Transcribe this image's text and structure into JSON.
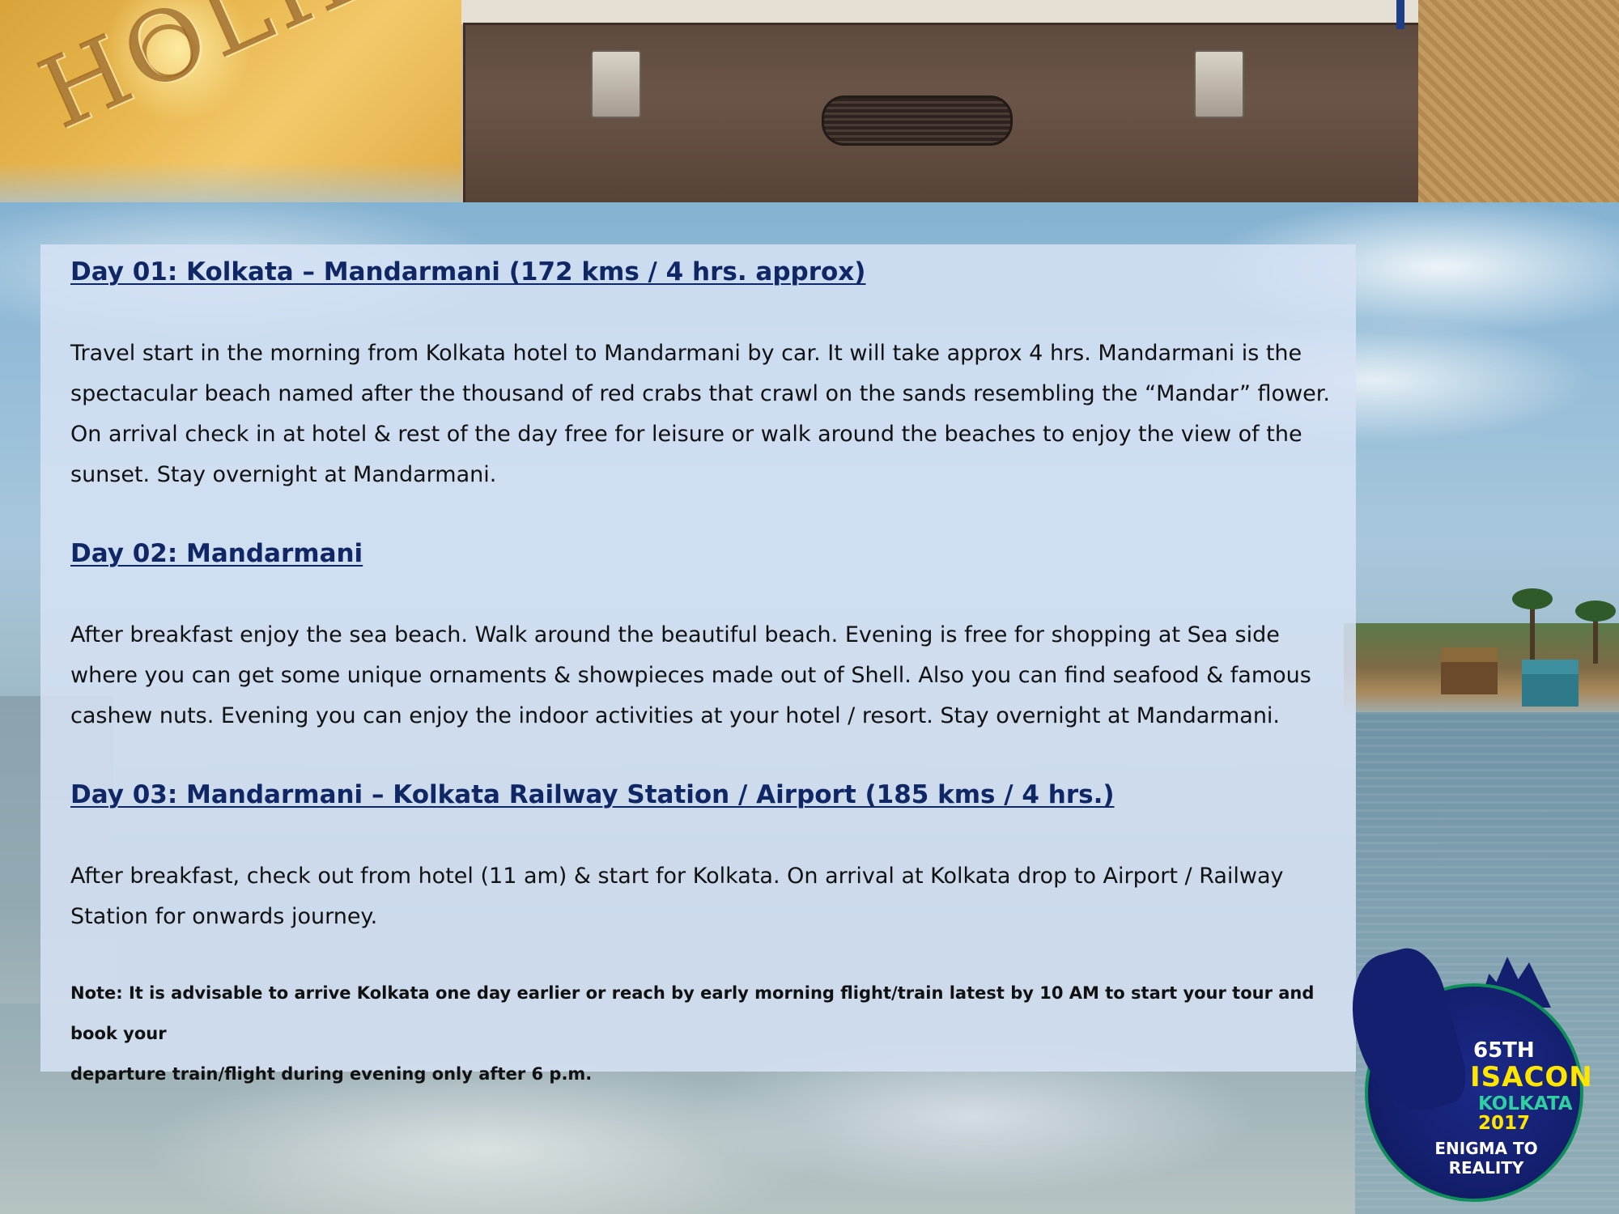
{
  "banner": {
    "holiday_word": "HOLIDAY"
  },
  "itinerary": {
    "day1": {
      "heading": "Day 01: Kolkata – Mandarmani (172 kms / 4 hrs. approx)",
      "body": "Travel start in the morning from Kolkata hotel to Mandarmani by car. It will take approx 4 hrs. Mandarmani is the\nspectacular beach named after the thousand of red crabs that crawl on the sands resembling the “Mandar” flower.\nOn arrival check in at hotel & rest of the day free for leisure or walk around the beaches to enjoy the view of the\nsunset. Stay overnight at Mandarmani."
    },
    "day2": {
      "heading": "Day 02: Mandarmani",
      "body": "After breakfast enjoy the sea beach. Walk around the beautiful beach. Evening is free for shopping at Sea side\nwhere you can get some unique ornaments & showpieces made out of Shell. Also you can find seafood & famous\ncashew nuts. Evening you can enjoy the indoor activities at your hotel / resort. Stay overnight at Mandarmani."
    },
    "day3": {
      "heading": "Day 03: Mandarmani – Kolkata Railway Station / Airport (185 kms / 4 hrs.)",
      "body": "After breakfast, check out from hotel (11 am) & start for Kolkata. On arrival at Kolkata drop to Airport / Railway\nStation for onwards journey."
    },
    "note": "Note:  It is advisable to arrive Kolkata one day earlier or reach by early morning flight/train latest by 10 AM to start your tour and book your\ndeparture train/flight during evening only after 6 p.m."
  },
  "logo": {
    "edition": "65TH",
    "name": "ISACON",
    "city": "KOLKATA",
    "year": "2017",
    "tagline": "ENIGMA TO REALITY"
  },
  "colors": {
    "heading": "#102766",
    "body_text": "#111111",
    "panel_bg": "#d6e2f4"
  }
}
